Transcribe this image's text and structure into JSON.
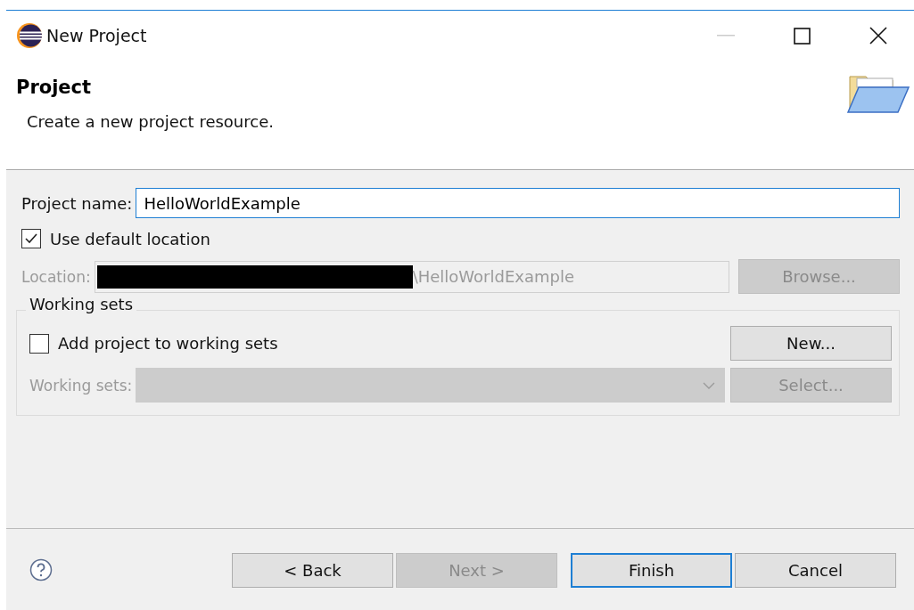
{
  "window": {
    "title": "New Project"
  },
  "header": {
    "title": "Project",
    "description": "Create a new project resource."
  },
  "project_name": {
    "label": "Project name:",
    "value": "HelloWorldExample"
  },
  "use_default_location": {
    "label": "Use default location",
    "checked": true
  },
  "location": {
    "label": "Location:",
    "value": "\\HelloWorldExample",
    "disabled": true,
    "browse": {
      "label": "Browse...",
      "disabled": true
    }
  },
  "working_sets": {
    "title": "Working sets",
    "add": {
      "label": "Add project to working sets",
      "checked": false
    },
    "new_button": {
      "label": "New...",
      "disabled": false
    },
    "field": {
      "label": "Working sets:",
      "disabled": true
    },
    "select_button": {
      "label": "Select...",
      "disabled": true
    }
  },
  "buttons": [
    {
      "label": "< Back",
      "disabled": false,
      "default": false
    },
    {
      "label": "Next >",
      "disabled": true,
      "default": false
    },
    {
      "label": "Finish",
      "disabled": false,
      "default": true
    },
    {
      "label": "Cancel",
      "disabled": false,
      "default": false
    }
  ]
}
